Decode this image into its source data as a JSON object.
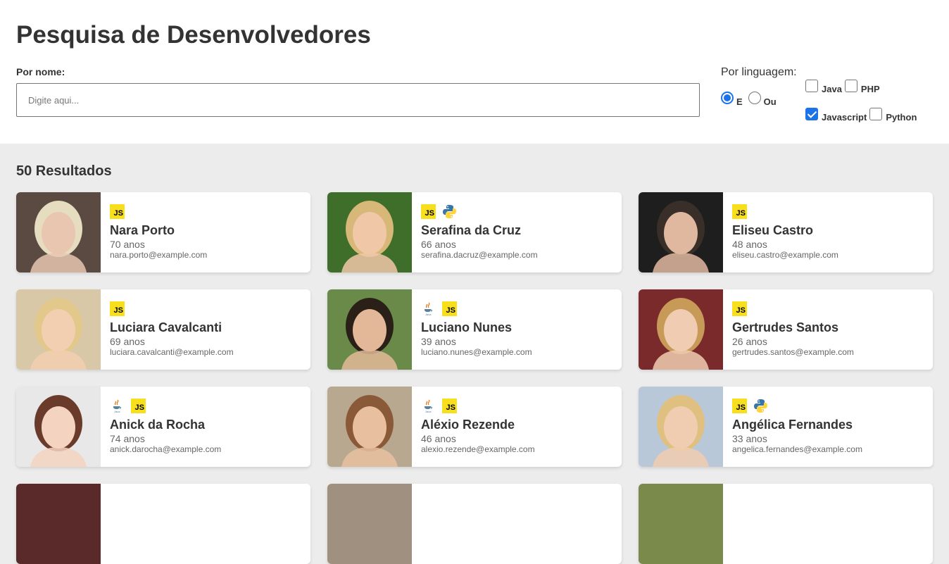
{
  "header": {
    "title": "Pesquisa de Desenvolvedores",
    "name_label": "Por nome:",
    "search_placeholder": "Digite aqui...",
    "search_value": "",
    "lang_label": "Por linguagem:",
    "operator": {
      "options": [
        {
          "label": "E",
          "checked": true
        },
        {
          "label": "Ou",
          "checked": false
        }
      ]
    },
    "languages": [
      {
        "label": "Java",
        "checked": false
      },
      {
        "label": "PHP",
        "checked": false
      },
      {
        "label": "Javascript",
        "checked": true
      },
      {
        "label": "Python",
        "checked": false
      }
    ]
  },
  "results": {
    "title": "50 Resultados",
    "developers": [
      {
        "name": "Nara Porto",
        "age": "70 anos",
        "email": "nara.porto@example.com",
        "langs": [
          "js-icon"
        ],
        "photo_bg": "#5a4a42",
        "photo_skin": "#e8c6b0",
        "photo_hair": "#e6dcc0"
      },
      {
        "name": "Serafina da Cruz",
        "age": "66 anos",
        "email": "serafina.dacruz@example.com",
        "langs": [
          "js-icon",
          "python-icon"
        ],
        "photo_bg": "#3f6e2a",
        "photo_skin": "#f0c8a8",
        "photo_hair": "#d8b878"
      },
      {
        "name": "Eliseu Castro",
        "age": "48 anos",
        "email": "eliseu.castro@example.com",
        "langs": [
          "js-icon"
        ],
        "photo_bg": "#1e1e1e",
        "photo_skin": "#e0b8a0",
        "photo_hair": "#3a2e28"
      },
      {
        "name": "Luciara Cavalcanti",
        "age": "69 anos",
        "email": "luciara.cavalcanti@example.com",
        "langs": [
          "js-icon"
        ],
        "photo_bg": "#d8c8a8",
        "photo_skin": "#f2cfb0",
        "photo_hair": "#e2c88a"
      },
      {
        "name": "Luciano Nunes",
        "age": "39 anos",
        "email": "luciano.nunes@example.com",
        "langs": [
          "java-icon",
          "js-icon"
        ],
        "photo_bg": "#6a8a4a",
        "photo_skin": "#e2b898",
        "photo_hair": "#2a2018"
      },
      {
        "name": "Gertrudes Santos",
        "age": "26 anos",
        "email": "gertrudes.santos@example.com",
        "langs": [
          "js-icon"
        ],
        "photo_bg": "#7a2a2a",
        "photo_skin": "#f0cdb2",
        "photo_hair": "#c89a58"
      },
      {
        "name": "Anick da Rocha",
        "age": "74 anos",
        "email": "anick.darocha@example.com",
        "langs": [
          "java-icon",
          "js-icon"
        ],
        "photo_bg": "#e8e8e8",
        "photo_skin": "#f4d4c0",
        "photo_hair": "#6a3a2a"
      },
      {
        "name": "Aléxio Rezende",
        "age": "46 anos",
        "email": "alexio.rezende@example.com",
        "langs": [
          "java-icon",
          "js-icon"
        ],
        "photo_bg": "#b8a890",
        "photo_skin": "#e8c0a0",
        "photo_hair": "#8a5a38"
      },
      {
        "name": "Angélica Fernandes",
        "age": "33 anos",
        "email": "angelica.fernandes@example.com",
        "langs": [
          "js-icon",
          "python-icon"
        ],
        "photo_bg": "#b8c8d8",
        "photo_skin": "#f0cdb0",
        "photo_hair": "#e0c080"
      },
      {
        "name": "",
        "age": "",
        "email": "",
        "langs": [],
        "photo_bg": "#5a2a2a",
        "photo_skin": "#5a2a2a",
        "photo_hair": "#5a2a2a"
      },
      {
        "name": "",
        "age": "",
        "email": "",
        "langs": [],
        "photo_bg": "#a09080",
        "photo_skin": "#a09080",
        "photo_hair": "#a09080"
      },
      {
        "name": "",
        "age": "",
        "email": "",
        "langs": [],
        "photo_bg": "#7a8a4a",
        "photo_skin": "#7a8a4a",
        "photo_hair": "#7a8a4a"
      }
    ]
  },
  "colors": {
    "accent": "#1a73e8",
    "js_yellow": "#f7df1e",
    "page_bg": "#ececec"
  }
}
